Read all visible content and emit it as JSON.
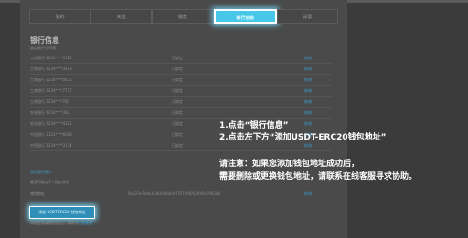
{
  "tabs": [
    "我的",
    "充值",
    "提款",
    "银行信息",
    "设置"
  ],
  "section": {
    "title": "银行信息",
    "subtitle": "绑定银行卡列表"
  },
  "bank_rows": [
    {
      "name": "工商银行 1234****0112",
      "status": "已绑定",
      "action": "修改"
    },
    {
      "name": "工商银行 1234****3423",
      "status": "已绑定",
      "action": "修改"
    },
    {
      "name": "工商银行 1234****0432",
      "status": "已绑定",
      "action": "修改"
    },
    {
      "name": "工商银行 1234****7777",
      "status": "已绑定",
      "action": "修改"
    },
    {
      "name": "工商银行 1234****780",
      "status": "已绑定",
      "action": "修改"
    },
    {
      "name": "农业银行 1234****362",
      "status": "已绑定",
      "action": "修改"
    },
    {
      "name": "农业银行 1234****4321",
      "status": "已绑定",
      "action": "修改"
    },
    {
      "name": "中国银行 1123****6098",
      "status": "已绑定",
      "action": "修改"
    },
    {
      "name": "中国银行 1234****3134",
      "status": "已绑定",
      "action": "修改"
    }
  ],
  "add_bank_link": "添加银行账户",
  "wallet": {
    "note": "最多可绑定5个钱包地址",
    "label": "钱包地址",
    "address": "0x023e7ada3c3b049a0a9f7074f40f23f40c5982d6",
    "action": "修改"
  },
  "add_wallet_button": "添加 USDT-ERC20 钱包地址",
  "footnote": {
    "text": "如需更换或删除钱包，请联系",
    "link": "在线客服"
  },
  "instructions": {
    "line1": "1.点击“银行信息”",
    "line2": "2.点击左下方“添加USDT-ERC20钱包地址”"
  },
  "notice": {
    "line1": "请注意：如果您添加钱包地址成功后，",
    "line2": "需要删除或更换钱包地址，请联系在线客服寻求协助。"
  },
  "colors": {
    "highlight": "#48c8e8",
    "link": "#3d9ed0",
    "overlay_text": "#ffffff"
  }
}
